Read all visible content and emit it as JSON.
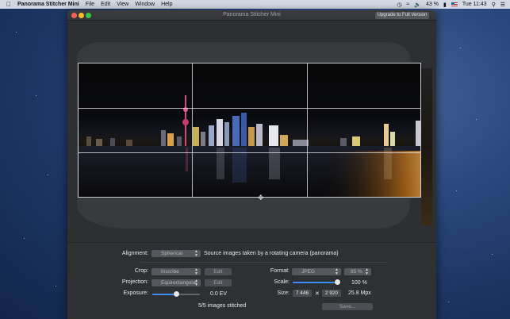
{
  "menubar": {
    "app_name": "Panorama Stitcher Mini",
    "menus": [
      "File",
      "Edit",
      "View",
      "Window",
      "Help"
    ],
    "battery": "43 %",
    "clock": "Tue 11:43"
  },
  "window": {
    "title": "Panorama Stitcher Mini",
    "upgrade_label": "Upgrade to Full Version"
  },
  "controls": {
    "alignment": {
      "label": "Alignment:",
      "value": "Spherical",
      "description": "Source images taken by a rotating camera (panorama)"
    },
    "crop": {
      "label": "Crop:",
      "value": "Inscribe",
      "edit_label": "Edit"
    },
    "projection": {
      "label": "Projection:",
      "value": "Equirectangular",
      "edit_label": "Edit"
    },
    "exposure": {
      "label": "Exposure:",
      "value": "0.0 EV",
      "level": 0.5
    },
    "status": "5/5 images stitched",
    "format": {
      "label": "Format:",
      "value": "JPEG",
      "quality": "85 %"
    },
    "scale": {
      "label": "Scale:",
      "value": "100 %",
      "level": 1.0
    },
    "size": {
      "label": "Size:",
      "width": "7 446",
      "times": "✕",
      "height": "2 920",
      "megapixels": "25.8 Mpx"
    },
    "save_label": "Save..."
  },
  "colors": {
    "accent": "#3a8ef6",
    "window_bg": "#2b2c30",
    "close": "#fc5f57",
    "minimize": "#fdbc2e",
    "zoom": "#33c748"
  },
  "icons": [
    "apple-icon",
    "time-machine-icon",
    "wifi-icon",
    "volume-icon",
    "battery-icon",
    "flag-icon",
    "spotlight-icon",
    "notification-center-icon",
    "move-cursor-icon"
  ]
}
